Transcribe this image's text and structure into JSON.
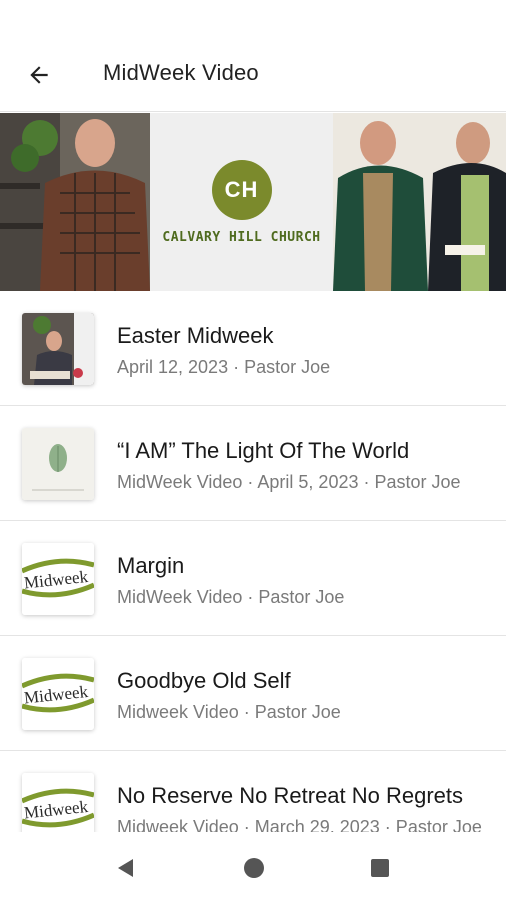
{
  "header": {
    "title": "MidWeek Video",
    "back_icon": "arrow-left-icon"
  },
  "banner": {
    "logo_text": "CH",
    "church_name": "CALVARY HILL CHURCH",
    "accent": "#7b8a2c"
  },
  "items": [
    {
      "title": "Easter Midweek",
      "subtitle": "April 12, 2023 · Pastor Joe",
      "thumb": "photo"
    },
    {
      "title": "“I AM” The Light Of The World",
      "subtitle": "MidWeek Video · April 5, 2023 · Pastor Joe",
      "thumb": "leaf"
    },
    {
      "title": "Margin",
      "subtitle": "MidWeek Video · Pastor Joe",
      "thumb": "midweek",
      "thumb_text": "Midweek"
    },
    {
      "title": "Goodbye Old Self",
      "subtitle": "Midweek Video · Pastor Joe",
      "thumb": "midweek",
      "thumb_text": "Midweek"
    },
    {
      "title": "No Reserve No Retreat No Regrets",
      "subtitle": "Midweek Video · March 29, 2023 · Pastor Joe",
      "thumb": "midweek",
      "thumb_text": "Midweek"
    }
  ],
  "navbar": {
    "back": "triangle-back-icon",
    "home": "circle-home-icon",
    "recents": "square-recents-icon"
  }
}
